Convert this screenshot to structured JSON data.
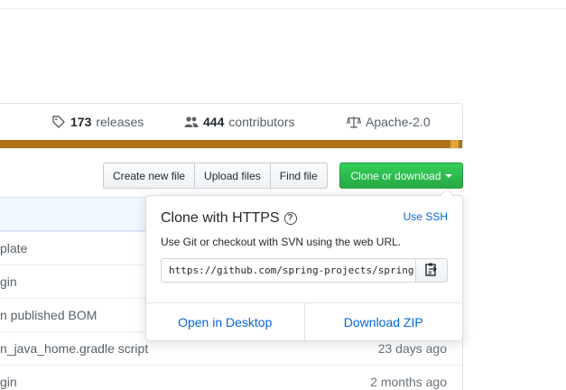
{
  "summary": {
    "releases": {
      "count": "173",
      "label": "releases",
      "icon": "tag-icon"
    },
    "contributors": {
      "count": "444",
      "label": "contributors",
      "icon": "people-icon"
    },
    "license": {
      "label": "Apache-2.0",
      "icon": "law-icon"
    },
    "language_bar": [
      {
        "color": "#b07219",
        "fraction": 0.98
      },
      {
        "color": "#e3a33c",
        "fraction": 0.02
      }
    ]
  },
  "toolbar": {
    "create_new_file": "Create new file",
    "upload_files": "Upload files",
    "find_file": "Find file",
    "clone_or_download": "Clone or download"
  },
  "files": [
    {
      "message": "plate",
      "age": ""
    },
    {
      "message": "gin",
      "age": ""
    },
    {
      "message": "n published BOM",
      "age": ""
    },
    {
      "message": "n_java_home.gradle script",
      "age": "23 days ago"
    },
    {
      "message": "gin",
      "age": "2 months ago"
    }
  ],
  "clone_dropdown": {
    "title": "Clone with HTTPS",
    "help_icon": "question-icon",
    "use_ssh": "Use SSH",
    "description": "Use Git or checkout with SVN using the web URL.",
    "url": "https://github.com/spring-projects/spring",
    "copy_icon": "clipboard-icon",
    "open_in_desktop": "Open in Desktop",
    "download_zip": "Download ZIP"
  },
  "colors": {
    "primary_button": "#28a745",
    "link": "#0366d6"
  }
}
